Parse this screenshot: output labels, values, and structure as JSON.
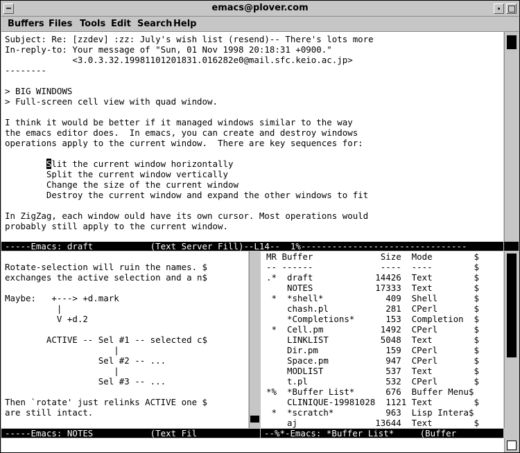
{
  "window": {
    "title": "emacs@plover.com"
  },
  "menubar": {
    "items": [
      "Buffers",
      "Files",
      "Tools",
      "Edit",
      "Search",
      "Help"
    ]
  },
  "top_pane": {
    "lines": [
      "Subject: Re: [zzdev] :zz: July's wish list (resend)-- There's lots more",
      "In-reply-to: Your message of \"Sun, 01 Nov 1998 20:18:31 +0900.\"",
      "             <3.0.3.32.19981101201831.016282e0@mail.sfc.keio.ac.jp>",
      "--------",
      "",
      "> BIG WINDOWS",
      "> Full-screen cell view with quad window.",
      "",
      "I think it would be better if it managed windows similar to the way",
      "the emacs editor does.  In emacs, you can create and destroy windows",
      "operations apply to the current window.  There are key sequences for:",
      "",
      "        Split the current window horizontally",
      "        Split the current window vertically",
      "        Change the size of the current window",
      "        Destroy the current window and expand the other windows to fit",
      "",
      "In ZigZag, each window ould have its own cursor. Most operations would",
      "probably still apply to the current window."
    ],
    "cursor_char": "S",
    "modeline": "-----Emacs: draft           (Text Server Fill)--L14--  1%--------------------------------"
  },
  "bottom_left_pane": {
    "lines": [
      "Rotate-selection will ruin the names. $",
      "exchanges the active selection and a n$",
      "",
      "Maybe:   +---> +d.mark",
      "          |",
      "          V +d.2",
      "",
      "        ACTIVE -- Sel #1 -- selected c$",
      "                     |",
      "                  Sel #2 -- ...",
      "                     |",
      "                  Sel #3 -- ...",
      "",
      "Then `rotate' just relinks ACTIVE one $",
      "are still intact."
    ],
    "modeline": "-----Emacs: NOTES           (Text Fil"
  },
  "bottom_right_pane": {
    "lines": [
      "MR Buffer             Size  Mode        $",
      "-- ------             ----  ----        $",
      ".*  draft            14426  Text        $",
      "    NOTES            17333  Text        $",
      " *  *shell*            409  Shell       $",
      "    chash.pl           281  CPerl       $",
      "    *Completions*      153  Completion  $",
      " *  Cell.pm           1492  CPerl       $",
      "    LINKLIST          5048  Text        $",
      "    Dir.pm             159  CPerl       $",
      "    Space.pm           947  CPerl       $",
      "    MODLIST            537  Text        $",
      "    t.pl               532  CPerl       $",
      "*%  *Buffer List*      676  Buffer Menu$",
      "    CLINIQUE-19981028  1121 Text        $",
      " *  *scratch*          963  Lisp Intera$",
      "    aj               13644  Text        $"
    ],
    "modeline": "--%*-Emacs: *Buffer List*     (Buffer"
  }
}
